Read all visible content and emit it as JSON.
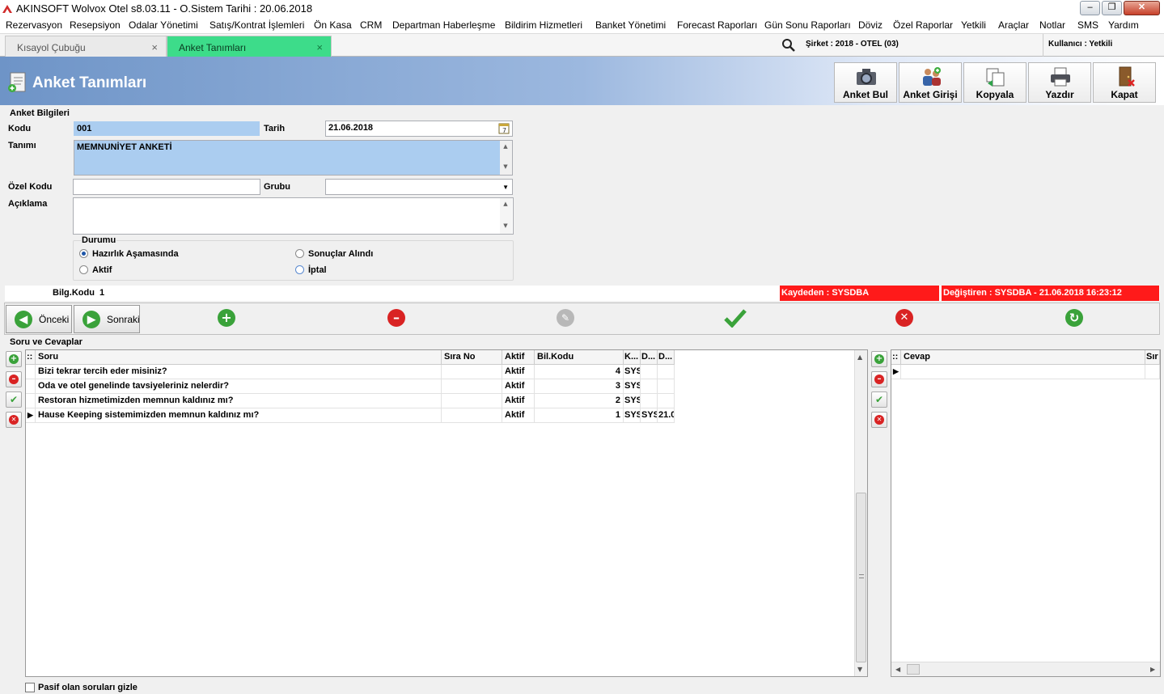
{
  "window": {
    "title": "AKINSOFT Wolvox Otel s8.03.11 - O.Sistem Tarihi : 20.06.2018"
  },
  "menu": [
    "Rezervasyon",
    "Resepsiyon",
    "Odalar Yönetimi",
    "Satış/Kontrat İşlemleri",
    "Ön Kasa",
    "CRM",
    "Departman Haberleşme",
    "Bildirim Hizmetleri",
    "Banket Yönetimi",
    "Forecast Raporları",
    "Gün Sonu Raporları",
    "Döviz",
    "Özel Raporlar",
    "Yetkili",
    "Araçlar",
    "Notlar",
    "SMS",
    "Yardım"
  ],
  "tabs": [
    {
      "label": "Kısayol Çubuğu",
      "active": false
    },
    {
      "label": "Anket Tanımları",
      "active": true
    }
  ],
  "session": {
    "company": "Şirket : 2018 - OTEL (03)",
    "user": "Kullanıcı : Yetkili"
  },
  "page": {
    "title": "Anket Tanımları"
  },
  "toolbar": [
    "Anket Bul",
    "Anket Girişi",
    "Kopyala",
    "Yazdır",
    "Kapat"
  ],
  "form": {
    "section": "Anket Bilgileri",
    "kodu_label": "Kodu",
    "kodu": "001",
    "tarih_label": "Tarih",
    "tarih": "21.06.2018",
    "tanimi_label": "Tanımı",
    "tanimi": "MEMNUNİYET ANKETİ",
    "ozel_kodu_label": "Özel Kodu",
    "ozel_kodu": "",
    "grubu_label": "Grubu",
    "grubu": "",
    "aciklama_label": "Açıklama",
    "aciklama": "",
    "durum_label": "Durumu",
    "durum_options": [
      "Hazırlık Aşamasında",
      "Sonuçlar Alındı",
      "Aktif",
      "İptal"
    ],
    "durum_selected": "Hazırlık Aşamasında"
  },
  "status": {
    "bilg_kodu_label": "Bilg.Kodu",
    "bilg_kodu": "1",
    "kaydeden": "Kaydeden : SYSDBA",
    "degistiren": "Değiştiren : SYSDBA - 21.06.2018 16:23:12"
  },
  "nav": {
    "prev": "Önceki",
    "next": "Sonraki"
  },
  "questions": {
    "section": "Soru ve Cevaplar",
    "columns": [
      "Soru",
      "Sıra No",
      "Aktif",
      "Bil.Kodu",
      "K...",
      "D...",
      "D..."
    ],
    "rows": [
      {
        "soru": "Bizi tekrar tercih eder misiniz?",
        "sira": "",
        "aktif": "Aktif",
        "bil": "4",
        "k": "SYS",
        "d1": "",
        "d2": ""
      },
      {
        "soru": "Oda ve otel genelinde tavsiyeleriniz nelerdir?",
        "sira": "",
        "aktif": "Aktif",
        "bil": "3",
        "k": "SYS",
        "d1": "",
        "d2": ""
      },
      {
        "soru": "Restoran hizmetimizden memnun kaldınız mı?",
        "sira": "",
        "aktif": "Aktif",
        "bil": "2",
        "k": "SYS",
        "d1": "",
        "d2": ""
      },
      {
        "soru": "Hause Keeping sistemimizden memnun kaldınız mı?",
        "sira": "",
        "aktif": "Aktif",
        "bil": "1",
        "k": "SYS",
        "d1": "SYS",
        "d2": "21.0"
      }
    ]
  },
  "answers": {
    "columns": [
      "Cevap",
      "Sır"
    ]
  },
  "footer": {
    "hide_passive": "Pasif olan soruları gizle"
  }
}
